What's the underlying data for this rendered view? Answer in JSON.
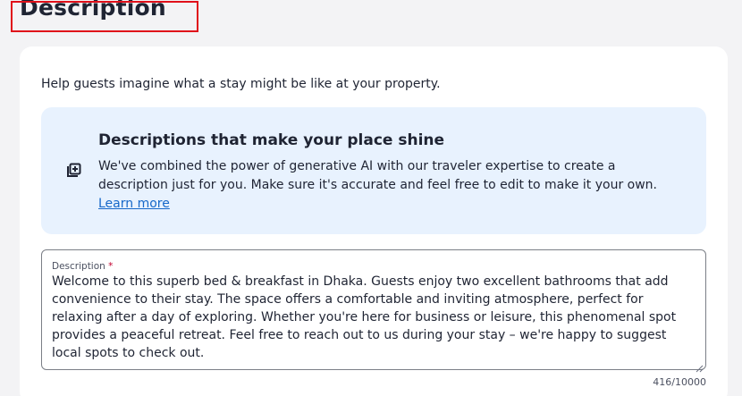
{
  "page": {
    "title": "Description"
  },
  "card": {
    "intro": "Help guests imagine what a stay might be like at your property."
  },
  "ai_panel": {
    "icon": "ai-sparkle-edit-icon",
    "heading": "Descriptions that make your place shine",
    "body": "We've combined the power of generative AI with our traveler expertise to create a description just for you. Make sure it's accurate and feel free to edit to make it your own.",
    "link_label": "Learn more"
  },
  "description_field": {
    "label": "Description",
    "required_marker": "*",
    "value": "Welcome to this superb bed & breakfast in Dhaka. Guests enjoy two excellent bathrooms that add convenience to their stay. The space offers a comfortable and inviting atmosphere, perfect for relaxing after a day of exploring. Whether you're here for business or leisure, this phenomenal spot provides a peaceful retreat. Feel free to reach out to us during your stay – we're happy to suggest local spots to check out.",
    "counter": "416/10000"
  },
  "colors": {
    "highlight_border": "#e0101a",
    "panel_background": "#e8f2fe",
    "link": "#1668c9",
    "required": "#c3002f"
  }
}
